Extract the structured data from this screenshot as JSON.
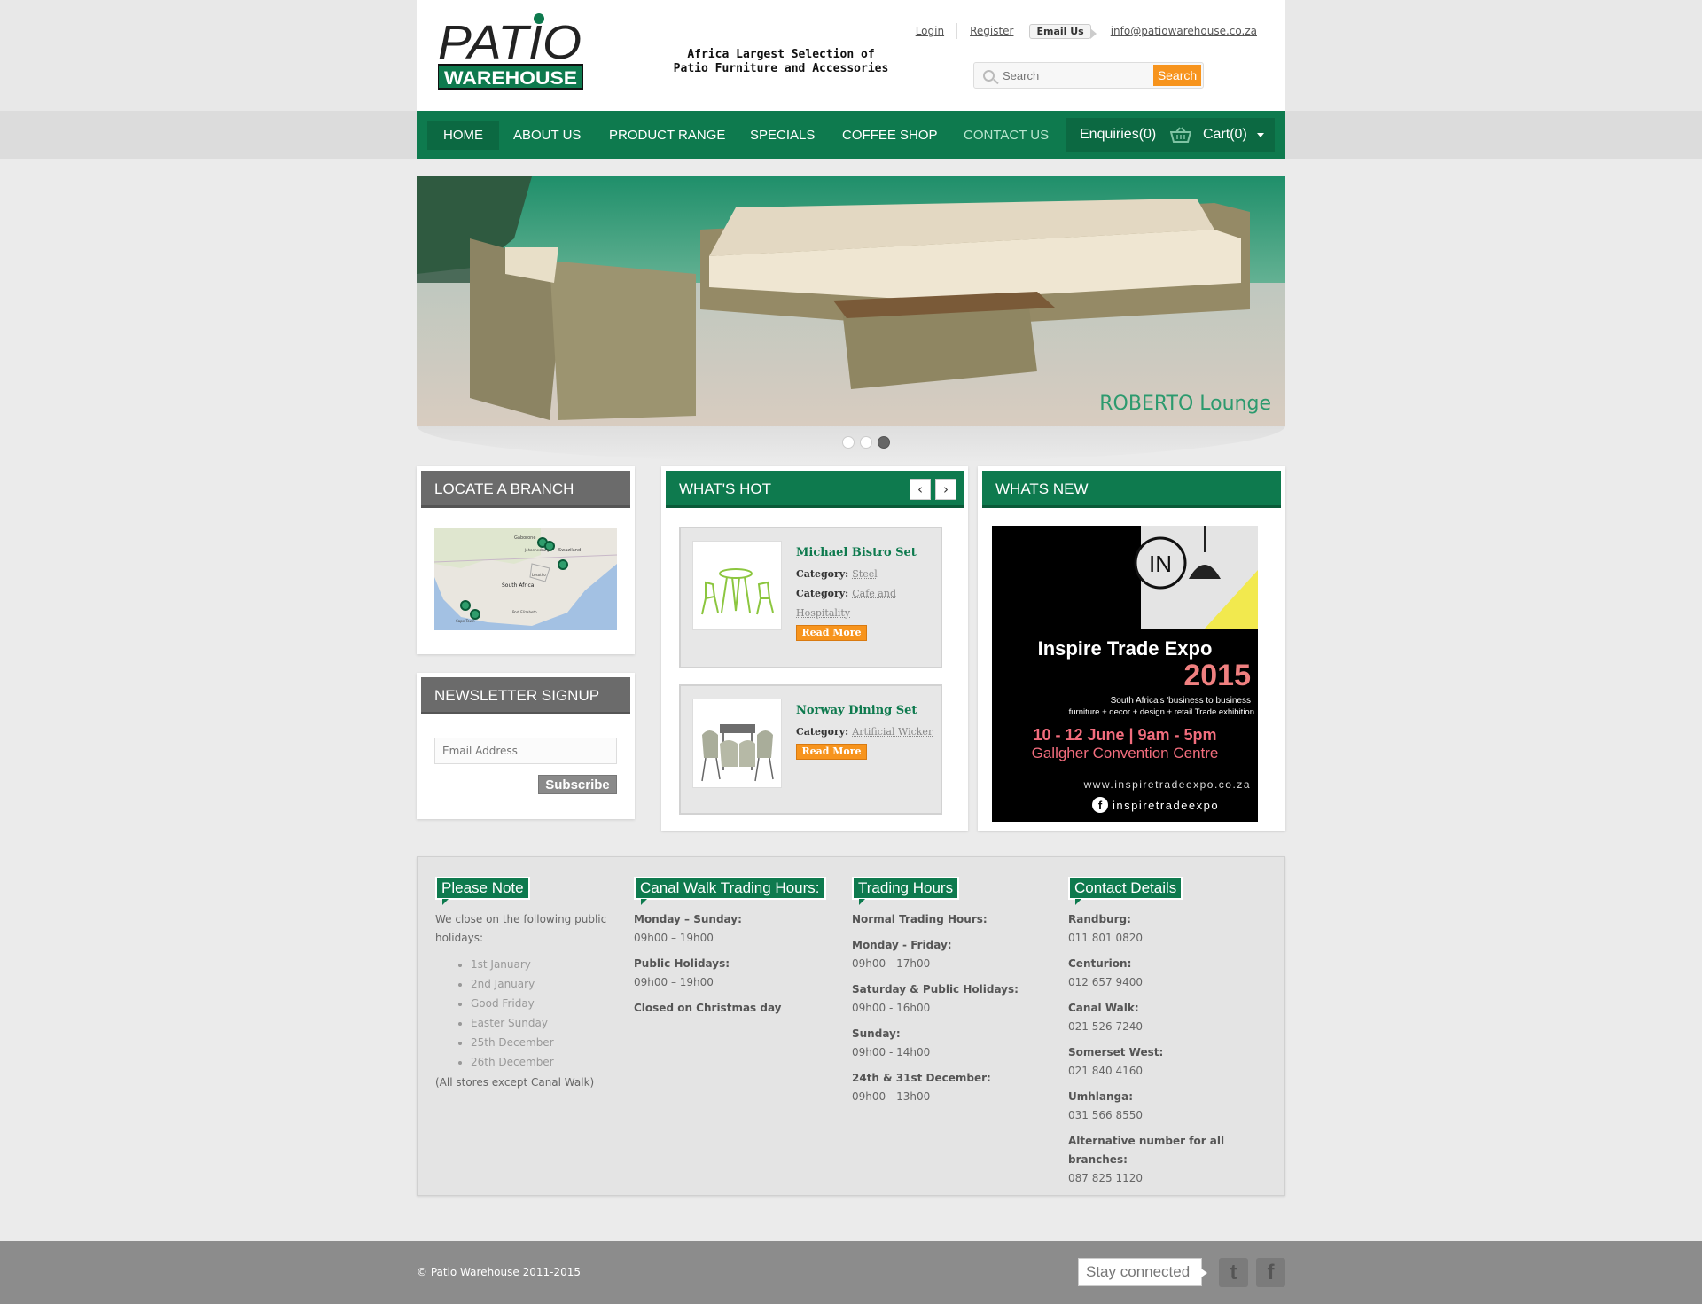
{
  "header": {
    "logo_top": "PATIO",
    "logo_bottom": "WAREHOUSE",
    "tagline_line1": "Africa Largest Selection of",
    "tagline_line2": "Patio Furniture and Accessories",
    "login": "Login",
    "register": "Register",
    "email_us": "Email Us",
    "email": "info@patiowarehouse.co.za",
    "search_placeholder": "Search",
    "search_button": "Search"
  },
  "nav": {
    "items": [
      "HOME",
      "ABOUT US",
      "PRODUCT RANGE",
      "SPECIALS",
      "COFFEE SHOP",
      "CONTACT US"
    ],
    "active": "HOME",
    "enquiries": "Enquiries(0)",
    "cart": "Cart(0)"
  },
  "slider": {
    "caption": "ROBERTO Lounge",
    "slide_count": 3,
    "active_slide": 3
  },
  "locate": {
    "title": "LOCATE A BRANCH",
    "map_labels": [
      "Gaborone",
      "Johannesburg",
      "Swaziland",
      "Lesotho",
      "South Africa",
      "Port Elizabeth",
      "Cape Town"
    ]
  },
  "newsletter": {
    "title": "NEWSLETTER SIGNUP",
    "placeholder": "Email Address",
    "button": "Subscribe"
  },
  "whats_hot": {
    "title": "WHAT'S HOT",
    "prev": "‹",
    "next": "›",
    "items": [
      {
        "name": "Michael Bistro Set",
        "category_label": "Category:",
        "categories": [
          "Steel",
          "Cafe and Hospitality"
        ],
        "button": "Read More"
      },
      {
        "name": "Norway Dining Set",
        "category_label": "Category:",
        "categories": [
          "Artificial Wicker"
        ],
        "button": "Read More"
      }
    ]
  },
  "whats_new": {
    "title": "WHATS NEW",
    "expo": {
      "logo": "IN",
      "title": "Inspire Trade Expo",
      "year": "2015",
      "sub1": "South Africa's 'business to business",
      "sub2": "furniture + decor + design + retail Trade exhibition",
      "dates": "10 - 12 June | 9am - 5pm",
      "venue": "Gallgher Convention Centre",
      "url": "www.inspiretradeexpo.co.za",
      "fb": "inspiretradeexpo"
    }
  },
  "info": {
    "note": {
      "title": "Please Note",
      "intro": "We close on the following public holidays:",
      "holidays": [
        "1st January",
        "2nd January",
        "Good Friday",
        "Easter Sunday",
        "25th December",
        "26th December"
      ],
      "footnote": "(All stores except Canal Walk)"
    },
    "canal": {
      "title": "Canal Walk Trading Hours:",
      "l1": "Monday – Sunday:",
      "v1": "09h00 – 19h00",
      "l2": "Public Holidays:",
      "v2": "09h00 – 19h00",
      "l3": "Closed on Christmas day"
    },
    "hours": {
      "title": "Trading Hours",
      "heading": "Normal Trading Hours:",
      "l1": "Monday - Friday:",
      "v1": "09h00 - 17h00",
      "l2": "Saturday & Public Holidays:",
      "v2": "09h00 - 16h00",
      "l3": "Sunday:",
      "v3": "09h00 - 14h00",
      "l4": "24th & 31st December:",
      "v4": "09h00 - 13h00"
    },
    "contact": {
      "title": "Contact Details",
      "entries": [
        {
          "branch": "Randburg:",
          "phone": "011 801 0820"
        },
        {
          "branch": "Centurion:",
          "phone": "012 657 9400"
        },
        {
          "branch": "Canal Walk:",
          "phone": "021 526 7240"
        },
        {
          "branch": "Somerset West:",
          "phone": "021 840 4160"
        },
        {
          "branch": "Umhlanga:",
          "phone": "031 566 8550"
        },
        {
          "branch": "Alternative number for all branches:",
          "phone": "087 825 1120"
        }
      ]
    }
  },
  "footer": {
    "copyright": "© Patio Warehouse 2011-2015",
    "stay_connected": "Stay connected",
    "twitter": "t",
    "facebook": "f"
  },
  "colors": {
    "brand_green": "#0e7a4e",
    "accent_orange": "#f7941d",
    "panel_gray": "#6b6b6b"
  }
}
